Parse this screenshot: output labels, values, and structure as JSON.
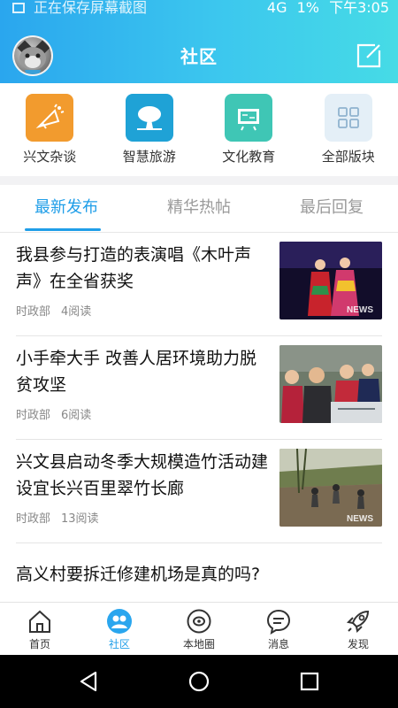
{
  "status_bar": {
    "notification": "正在保存屏幕截图",
    "network": "4G",
    "battery": "1%",
    "time": "下午3:05"
  },
  "header": {
    "title": "社区",
    "compose_icon": "compose-icon",
    "avatar_icon": "cat-avatar"
  },
  "sections": [
    {
      "label": "兴文杂谈",
      "icon": "megaphone-icon",
      "color": "#f29b2e"
    },
    {
      "label": "智慧旅游",
      "icon": "tree-icon",
      "color": "#1fa2d6"
    },
    {
      "label": "文化教育",
      "icon": "blackboard-icon",
      "color": "#3fc6b5"
    },
    {
      "label": "全部版块",
      "icon": "grid-icon",
      "color": "#e4eff7"
    }
  ],
  "tabs": [
    {
      "label": "最新发布",
      "active": true
    },
    {
      "label": "精华热帖",
      "active": false
    },
    {
      "label": "最后回复",
      "active": false
    }
  ],
  "articles": [
    {
      "title": "我县参与打造的表演唱《木叶声声》在全省获奖",
      "source": "时政部",
      "reads": "4阅读"
    },
    {
      "title": "小手牵大手 改善人居环境助力脱贫攻坚",
      "source": "时政部",
      "reads": "6阅读"
    },
    {
      "title": "兴文县启动冬季大规模造竹活动建设宜长兴百里翠竹长廊",
      "source": "时政部",
      "reads": "13阅读"
    },
    {
      "title": "高义村要拆迁修建机场是真的吗?"
    }
  ],
  "bottom_nav": [
    {
      "label": "首页",
      "icon": "home-icon",
      "active": false
    },
    {
      "label": "社区",
      "icon": "community-icon",
      "active": true
    },
    {
      "label": "本地圈",
      "icon": "local-circle-icon",
      "active": false
    },
    {
      "label": "消息",
      "icon": "message-icon",
      "active": false
    },
    {
      "label": "发现",
      "icon": "rocket-icon",
      "active": false
    }
  ],
  "colors": {
    "accent": "#1f9ee8",
    "header_gradient_start": "#2aa6ee",
    "header_gradient_end": "#46dbe6"
  }
}
